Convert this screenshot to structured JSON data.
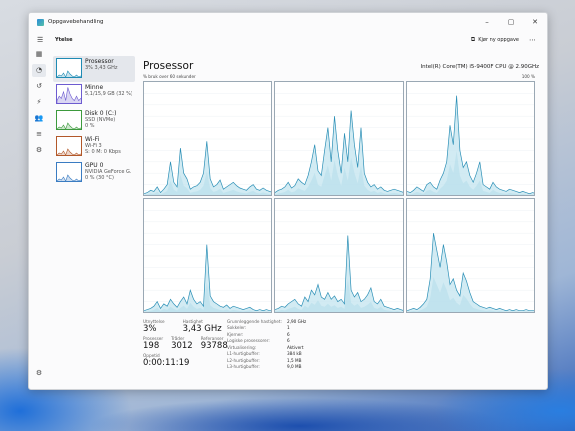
{
  "window": {
    "title": "Oppgavebehandling",
    "controls": [
      "–",
      "▢",
      "✕"
    ]
  },
  "toolbar": {
    "tab_title": "Ytelse",
    "run_task_label": "Kjør ny oppgave",
    "more_label": "⋯"
  },
  "sidebar": {
    "items": [
      {
        "name": "Prosessor",
        "line1": "3% 3,43 GHz",
        "line2": "",
        "selected": true,
        "color": "#1f8bb4"
      },
      {
        "name": "Minne",
        "line1": "5,1/15,9 GB (32 %)",
        "line2": "",
        "selected": false,
        "color": "#6d5bd0"
      },
      {
        "name": "Disk 0 (C:)",
        "line1": "SSD (NVMe)",
        "line2": "0 %",
        "selected": false,
        "color": "#3d9a3d"
      },
      {
        "name": "Wi-Fi",
        "line1": "Wi-Fi 3",
        "line2": "S: 0 M: 0 Kbps",
        "selected": false,
        "color": "#b2582a"
      },
      {
        "name": "GPU 0",
        "line1": "NVIDIA GeForce G...",
        "line2": "0 % (30 °C)",
        "selected": false,
        "color": "#3a7cc2"
      }
    ]
  },
  "main": {
    "title": "Prosessor",
    "cpu_model": "Intel(R) Core(TM) i5-9400F CPU @ 2.90GHz",
    "graph_caption_left": "% bruk over 60 sekunder",
    "graph_caption_right": "100 %"
  },
  "stats": {
    "utilization_label": "Utnyttelse",
    "utilization": "3%",
    "speed_label": "Hastighet",
    "speed": "3,43 GHz",
    "processes_label": "Prosesser",
    "processes": "198",
    "threads_label": "Tråder",
    "threads": "3012",
    "handles_label": "Referanser",
    "handles": "93788",
    "uptime_label": "Oppetid",
    "uptime": "0:00:11:19"
  },
  "details": [
    {
      "k": "Grunnleggende hastighet:",
      "v": "2,90 GHz"
    },
    {
      "k": "Sokkeler:",
      "v": "1"
    },
    {
      "k": "Kjerner:",
      "v": "6"
    },
    {
      "k": "Logiske prosessorer:",
      "v": "6"
    },
    {
      "k": "Virtualisering:",
      "v": "Aktivert"
    },
    {
      "k": "L1-hurtigbuffer:",
      "v": "384 kB"
    },
    {
      "k": "L2-hurtigbuffer:",
      "v": "1,5 MB"
    },
    {
      "k": "L3-hurtigbuffer:",
      "v": "9,0 MB"
    }
  ],
  "colors": {
    "accent": "#1f8bb4",
    "graph_fill": "#bfe3ee",
    "graph_line": "#2b8fb6"
  },
  "icons": {
    "nav": [
      "hamburger-icon",
      "processes-icon",
      "performance-icon",
      "app-history-icon",
      "startup-icon",
      "users-icon",
      "details-icon",
      "services-icon",
      "settings-icon"
    ]
  },
  "graphs": [
    [
      2,
      3,
      5,
      4,
      8,
      3,
      6,
      10,
      30,
      12,
      8,
      42,
      20,
      15,
      6,
      8,
      9,
      12,
      20,
      48,
      15,
      8,
      10,
      14,
      6,
      8,
      10,
      12,
      9,
      7,
      6,
      5,
      8,
      10,
      6,
      5,
      7,
      5,
      4,
      3
    ],
    [
      3,
      5,
      6,
      8,
      12,
      7,
      9,
      15,
      12,
      10,
      18,
      30,
      45,
      22,
      18,
      40,
      60,
      30,
      70,
      40,
      20,
      55,
      30,
      75,
      45,
      25,
      60,
      20,
      12,
      8,
      10,
      6,
      8,
      5,
      4,
      5,
      6,
      5,
      4,
      3
    ],
    [
      4,
      3,
      5,
      8,
      6,
      4,
      10,
      12,
      8,
      6,
      14,
      20,
      30,
      62,
      45,
      88,
      40,
      25,
      30,
      18,
      12,
      20,
      30,
      10,
      8,
      6,
      12,
      8,
      6,
      5,
      4,
      6,
      5,
      4,
      3,
      4,
      3,
      2,
      3,
      2
    ],
    [
      2,
      3,
      4,
      6,
      10,
      4,
      8,
      6,
      12,
      8,
      5,
      10,
      14,
      8,
      20,
      12,
      8,
      10,
      6,
      60,
      15,
      10,
      8,
      6,
      5,
      7,
      4,
      6,
      5,
      4,
      3,
      4,
      5,
      3,
      2,
      3,
      2,
      3,
      2,
      2
    ],
    [
      3,
      4,
      6,
      5,
      8,
      10,
      12,
      8,
      6,
      14,
      10,
      20,
      16,
      25,
      14,
      12,
      18,
      12,
      15,
      10,
      12,
      8,
      68,
      20,
      14,
      18,
      10,
      12,
      16,
      22,
      10,
      8,
      12,
      6,
      5,
      4,
      3,
      4,
      3,
      2
    ],
    [
      2,
      3,
      4,
      3,
      5,
      8,
      12,
      30,
      70,
      55,
      40,
      60,
      45,
      25,
      30,
      20,
      15,
      35,
      28,
      18,
      10,
      8,
      6,
      5,
      4,
      5,
      4,
      3,
      4,
      3,
      2,
      3,
      2,
      3,
      2,
      2,
      3,
      2,
      2,
      2
    ]
  ]
}
